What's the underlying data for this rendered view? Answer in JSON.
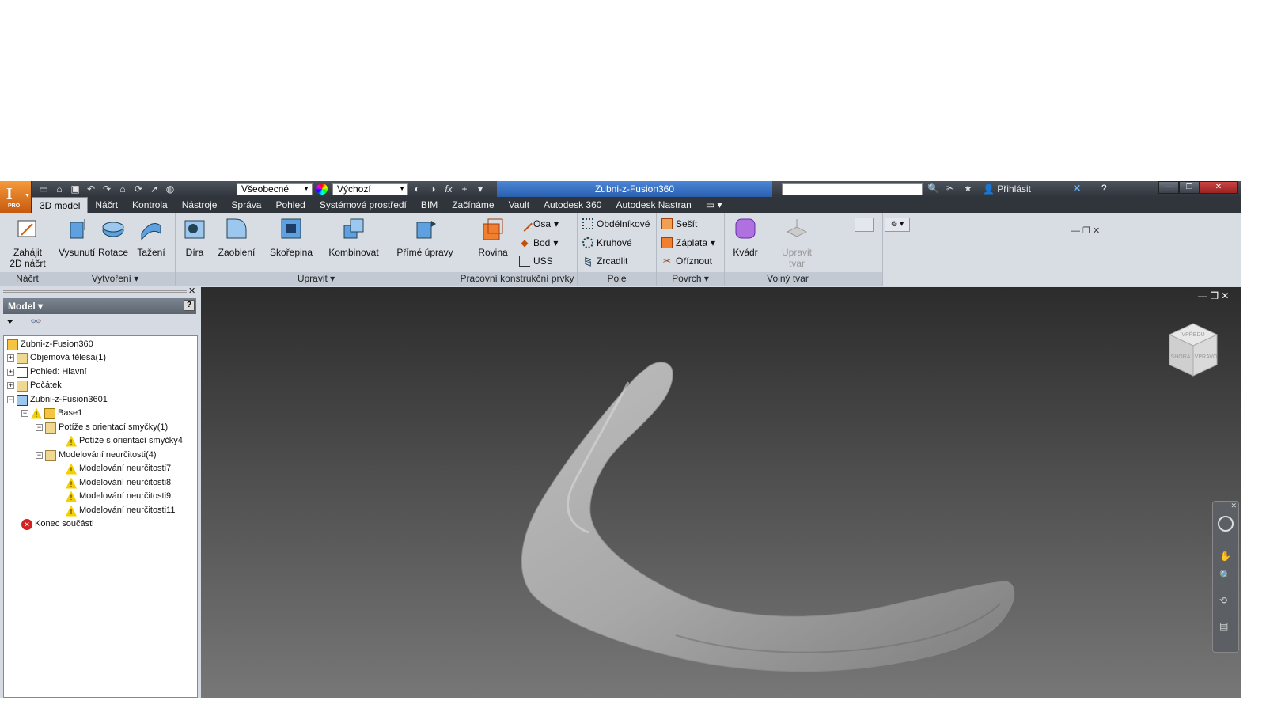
{
  "app": {
    "title": "Zubni-z-Fusion360",
    "badge": "PRO",
    "material_combo": "Všeobecné",
    "appearance_combo": "Výchozí",
    "login": "Přihlásit"
  },
  "tabs": [
    "3D model",
    "Náčrt",
    "Kontrola",
    "Nástroje",
    "Správa",
    "Pohled",
    "Systémové prostředí",
    "BIM",
    "Začínáme",
    "Vault",
    "Autodesk 360",
    "Autodesk Nastran"
  ],
  "ribbon": {
    "sketch": {
      "start": "Zahájit",
      "start2": "2D náčrt",
      "title": "Náčrt"
    },
    "create": {
      "extrude": "Vysunutí",
      "revolve": "Rotace",
      "sweep": "Tažení",
      "title": "Vytvoření"
    },
    "modify": {
      "hole": "Díra",
      "fillet": "Zaoblení",
      "shell": "Skořepina",
      "combine": "Kombinovat",
      "direct": "Přímé úpravy",
      "title": "Upravit"
    },
    "work": {
      "plane": "Rovina",
      "axis": "Osa",
      "point": "Bod",
      "ucs": "USS",
      "title": "Pracovní konstrukční prvky"
    },
    "pattern": {
      "rect": "Obdélníkové",
      "circ": "Kruhové",
      "mirror": "Zrcadlit",
      "title": "Pole"
    },
    "surface": {
      "stitch": "Sešít",
      "patch": "Záplata",
      "trim": "Oříznout",
      "title": "Povrch"
    },
    "freeform": {
      "box": "Kvádr",
      "edit": "Upravit",
      "edit2": "tvar",
      "title": "Volný tvar"
    }
  },
  "browser": {
    "title": "Model",
    "tree": [
      "Zubni-z-Fusion360",
      "Objemová tělesa(1)",
      "Pohled: Hlavní",
      "Počátek",
      "Zubni-z-Fusion3601",
      "Base1",
      "Potíže s orientací smyčky(1)",
      "Potíže s orientací smyčky4",
      "Modelování neurčitosti(4)",
      "Modelování neurčitosti7",
      "Modelování neurčitosti8",
      "Modelování neurčitosti9",
      "Modelování neurčitosti11",
      "Konec součásti"
    ]
  },
  "viewcube": {
    "top": "SHORA",
    "right": "VPRAVO",
    "front": "VPŘEDU"
  },
  "colors": {
    "accent": "#2a5fb0",
    "app_button": "#e07820",
    "warning": "#f5d000",
    "error": "#d42020"
  }
}
